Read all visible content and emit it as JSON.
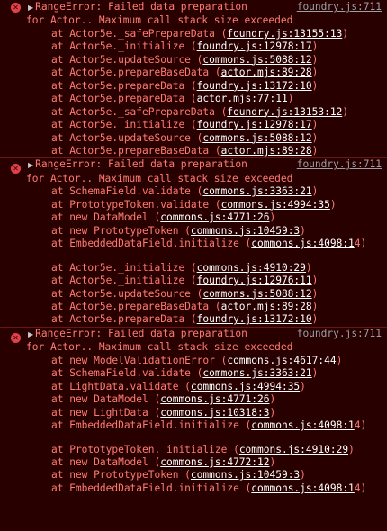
{
  "colors": {
    "background": "#290000",
    "error_text": "#ff7b72",
    "link": "#ffffff",
    "source_link": "#9aa0a6",
    "divider": "#6b1414",
    "error_icon": "#e3414a"
  },
  "errors": [
    {
      "icon": "error-circle-icon",
      "message_head": "RangeError: Failed data preparation",
      "message_tail": "for Actor.. Maximum call stack size exceeded",
      "source": "foundry.js:711",
      "frames": [
        {
          "prefix": "at Actor5e._safePrepareData (",
          "link": "foundry.js:13155:13",
          "suffix": ")"
        },
        {
          "prefix": "at Actor5e._initialize (",
          "link": "foundry.js:12978:17",
          "suffix": ")"
        },
        {
          "prefix": "at Actor5e.updateSource (",
          "link": "commons.js:5088:12",
          "suffix": ")"
        },
        {
          "prefix": "at Actor5e.prepareBaseData (",
          "link": "actor.mjs:89:28",
          "suffix": ")"
        },
        {
          "prefix": "at Actor5e.prepareData (",
          "link": "foundry.js:13172:10",
          "suffix": ")"
        },
        {
          "prefix": "at Actor5e.prepareData (",
          "link": "actor.mjs:77:11",
          "suffix": ")"
        },
        {
          "prefix": "at Actor5e._safePrepareData (",
          "link": "foundry.js:13153:12",
          "suffix": ")"
        },
        {
          "prefix": "at Actor5e._initialize (",
          "link": "foundry.js:12978:17",
          "suffix": ")"
        },
        {
          "prefix": "at Actor5e.updateSource (",
          "link": "commons.js:5088:12",
          "suffix": ")"
        },
        {
          "prefix": "at Actor5e.prepareBaseData (",
          "link": "actor.mjs:89:28",
          "suffix": ")"
        }
      ],
      "frames_after_gap": []
    },
    {
      "icon": "error-circle-icon",
      "message_head": "RangeError: Failed data preparation",
      "message_tail": "for Actor.. Maximum call stack size exceeded",
      "source": "foundry.js:711",
      "frames": [
        {
          "prefix": "at SchemaField.validate (",
          "link": "commons.js:3363:21",
          "suffix": ")"
        },
        {
          "prefix": "at PrototypeToken.validate (",
          "link": "commons.js:4994:35",
          "suffix": ")"
        },
        {
          "prefix": "at new DataModel (",
          "link": "commons.js:4771:26",
          "suffix": ")"
        },
        {
          "prefix": "at new PrototypeToken (",
          "link": "commons.js:10459:3",
          "suffix": ")"
        },
        {
          "prefix": "at EmbeddedDataField.initialize (",
          "link": "commons.js:4098:1",
          "suffix": "4)"
        }
      ],
      "frames_after_gap": [
        {
          "prefix": "at Actor5e._initialize (",
          "link": "commons.js:4910:29",
          "suffix": ")"
        },
        {
          "prefix": "at Actor5e._initialize (",
          "link": "foundry.js:12976:11",
          "suffix": ")"
        },
        {
          "prefix": "at Actor5e.updateSource (",
          "link": "commons.js:5088:12",
          "suffix": ")"
        },
        {
          "prefix": "at Actor5e.prepareBaseData (",
          "link": "actor.mjs:89:28",
          "suffix": ")"
        },
        {
          "prefix": "at Actor5e.prepareData (",
          "link": "foundry.js:13172:10",
          "suffix": ")"
        }
      ]
    },
    {
      "icon": "error-circle-icon",
      "message_head": "RangeError: Failed data preparation",
      "message_tail": "for Actor.. Maximum call stack size exceeded",
      "source": "foundry.js:711",
      "frames": [
        {
          "prefix": "at new ModelValidationError (",
          "link": "commons.js:4617:44",
          "suffix": ")"
        },
        {
          "prefix": "at SchemaField.validate (",
          "link": "commons.js:3363:21",
          "suffix": ")"
        },
        {
          "prefix": "at LightData.validate (",
          "link": "commons.js:4994:35",
          "suffix": ")"
        },
        {
          "prefix": "at new DataModel (",
          "link": "commons.js:4771:26",
          "suffix": ")"
        },
        {
          "prefix": "at new LightData (",
          "link": "commons.js:10318:3",
          "suffix": ")"
        },
        {
          "prefix": "at EmbeddedDataField.initialize (",
          "link": "commons.js:4098:1",
          "suffix": "4)"
        }
      ],
      "frames_after_gap": [
        {
          "prefix": "at PrototypeToken._initialize (",
          "link": "commons.js:4910:29",
          "suffix": ")"
        },
        {
          "prefix": "at new DataModel (",
          "link": "commons.js:4772:12",
          "suffix": ")"
        },
        {
          "prefix": "at new PrototypeToken (",
          "link": "commons.js:10459:3",
          "suffix": ")"
        },
        {
          "prefix": "at EmbeddedDataField.initialize (",
          "link": "commons.js:4098:1",
          "suffix": "4)"
        }
      ]
    }
  ]
}
